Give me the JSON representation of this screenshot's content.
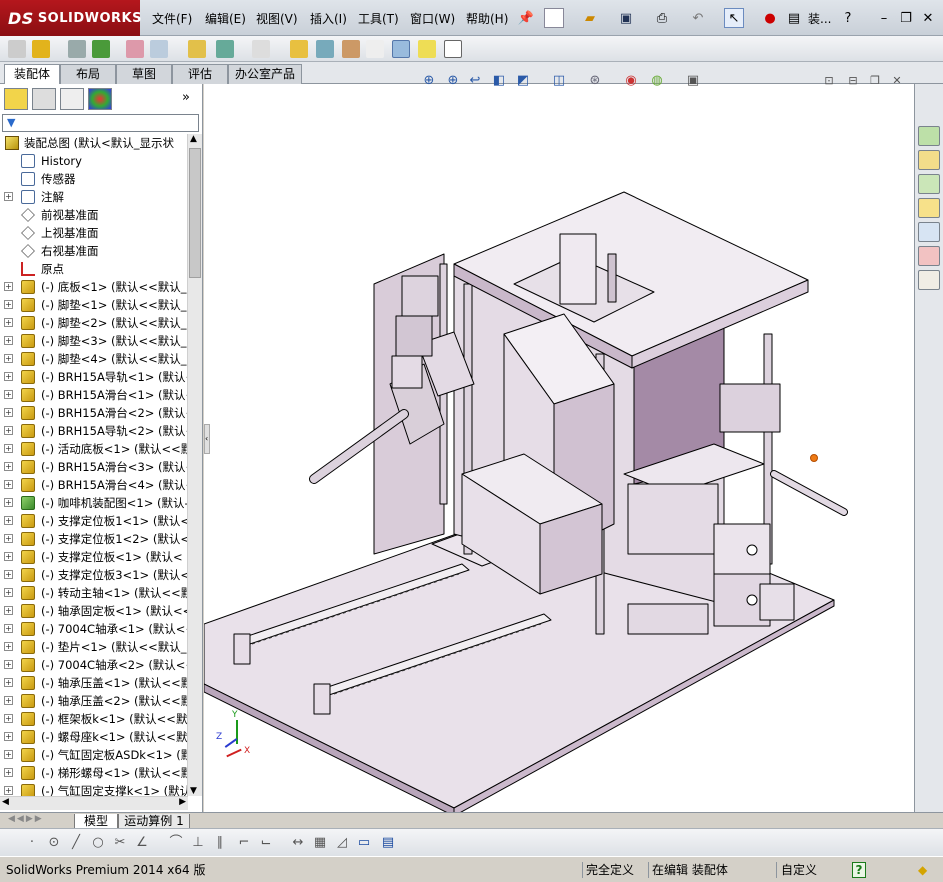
{
  "app": {
    "brand": "SOLIDWORKS",
    "brand_prefix": "DS"
  },
  "menu": {
    "items": [
      "文件(F)",
      "编辑(E)",
      "视图(V)",
      "插入(I)",
      "工具(T)",
      "窗口(W)",
      "帮助(H)"
    ],
    "search_label": "装..."
  },
  "command_tabs": [
    "装配体",
    "布局",
    "草图",
    "评估",
    "办公室产品"
  ],
  "tree": {
    "root": "装配总图 (默认<默认_显示状",
    "items": [
      {
        "label": "History",
        "icon": "history-icon",
        "expand": false
      },
      {
        "label": "传感器",
        "icon": "sensor-icon",
        "expand": false
      },
      {
        "label": "注解",
        "icon": "annotation-icon",
        "expand": true
      },
      {
        "label": "前视基准面",
        "icon": "plane-icon",
        "expand": false
      },
      {
        "label": "上视基准面",
        "icon": "plane-icon",
        "expand": false
      },
      {
        "label": "右视基准面",
        "icon": "plane-icon",
        "expand": false
      },
      {
        "label": "原点",
        "icon": "origin-icon",
        "expand": false
      },
      {
        "label": "(-) 底板<1> (默认<<默认_",
        "icon": "part-icon",
        "expand": true
      },
      {
        "label": "(-) 脚垫<1> (默认<<默认_",
        "icon": "part-icon",
        "expand": true
      },
      {
        "label": "(-) 脚垫<2> (默认<<默认_",
        "icon": "part-icon",
        "expand": true
      },
      {
        "label": "(-) 脚垫<3> (默认<<默认_",
        "icon": "part-icon",
        "expand": true
      },
      {
        "label": "(-) 脚垫<4> (默认<<默认_",
        "icon": "part-icon",
        "expand": true
      },
      {
        "label": "(-) BRH15A导轨<1> (默认<",
        "icon": "part-icon",
        "expand": true
      },
      {
        "label": "(-) BRH15A滑台<1> (默认<",
        "icon": "part-icon",
        "expand": true
      },
      {
        "label": "(-) BRH15A滑台<2> (默认<",
        "icon": "part-icon",
        "expand": true
      },
      {
        "label": "(-) BRH15A导轨<2> (默认<",
        "icon": "part-icon",
        "expand": true
      },
      {
        "label": "(-) 活动底板<1> (默认<<默",
        "icon": "part-icon",
        "expand": true
      },
      {
        "label": "(-) BRH15A滑台<3> (默认<",
        "icon": "part-icon",
        "expand": true
      },
      {
        "label": "(-) BRH15A滑台<4> (默认<",
        "icon": "part-icon",
        "expand": true
      },
      {
        "label": "(-) 咖啡机装配图<1> (默认-",
        "icon": "subassembly-icon",
        "expand": true
      },
      {
        "label": "(-) 支撑定位板1<1> (默认<",
        "icon": "part-icon",
        "expand": true
      },
      {
        "label": "(-) 支撑定位板1<2> (默认<",
        "icon": "part-icon",
        "expand": true
      },
      {
        "label": "(-) 支撑定位板<1> (默认<",
        "icon": "part-icon",
        "expand": true
      },
      {
        "label": "(-) 支撑定位板3<1> (默认<",
        "icon": "part-icon",
        "expand": true
      },
      {
        "label": "(-) 转动主轴<1> (默认<<默",
        "icon": "part-icon",
        "expand": true
      },
      {
        "label": "(-) 轴承固定板<1> (默认<<",
        "icon": "part-icon",
        "expand": true
      },
      {
        "label": "(-) 7004C轴承<1> (默认<<",
        "icon": "part-icon",
        "expand": true
      },
      {
        "label": "(-) 垫片<1> (默认<<默认_",
        "icon": "part-icon",
        "expand": true
      },
      {
        "label": "(-) 7004C轴承<2> (默认<<",
        "icon": "part-icon",
        "expand": true
      },
      {
        "label": "(-) 轴承压盖<1> (默认<<默",
        "icon": "part-icon",
        "expand": true
      },
      {
        "label": "(-) 轴承压盖<2> (默认<<默",
        "icon": "part-icon",
        "expand": true
      },
      {
        "label": "(-) 框架板k<1> (默认<<默认",
        "icon": "part-icon",
        "expand": true
      },
      {
        "label": "(-) 螺母座k<1> (默认<<默认",
        "icon": "part-icon",
        "expand": true
      },
      {
        "label": "(-) 气缸固定板ASDk<1> (默",
        "icon": "part-icon",
        "expand": true
      },
      {
        "label": "(-) 梯形螺母<1> (默认<<默",
        "icon": "part-icon",
        "expand": true
      },
      {
        "label": "(-) 气缸固定支撑k<1> (默认",
        "icon": "part-icon",
        "expand": true
      }
    ]
  },
  "bottom_tabs": [
    "模型",
    "运动算例 1"
  ],
  "status": {
    "product": "SolidWorks Premium 2014 x64 版",
    "definition": "完全定义",
    "editing": "在编辑 装配体",
    "units": "自定义",
    "help": "?"
  },
  "triad": {
    "x": "X",
    "y": "Y",
    "z": "Z"
  },
  "colors": {
    "brand_red": "#b5171d",
    "model_lavender": "#d9ccd9",
    "model_dark": "#a48aa6"
  }
}
